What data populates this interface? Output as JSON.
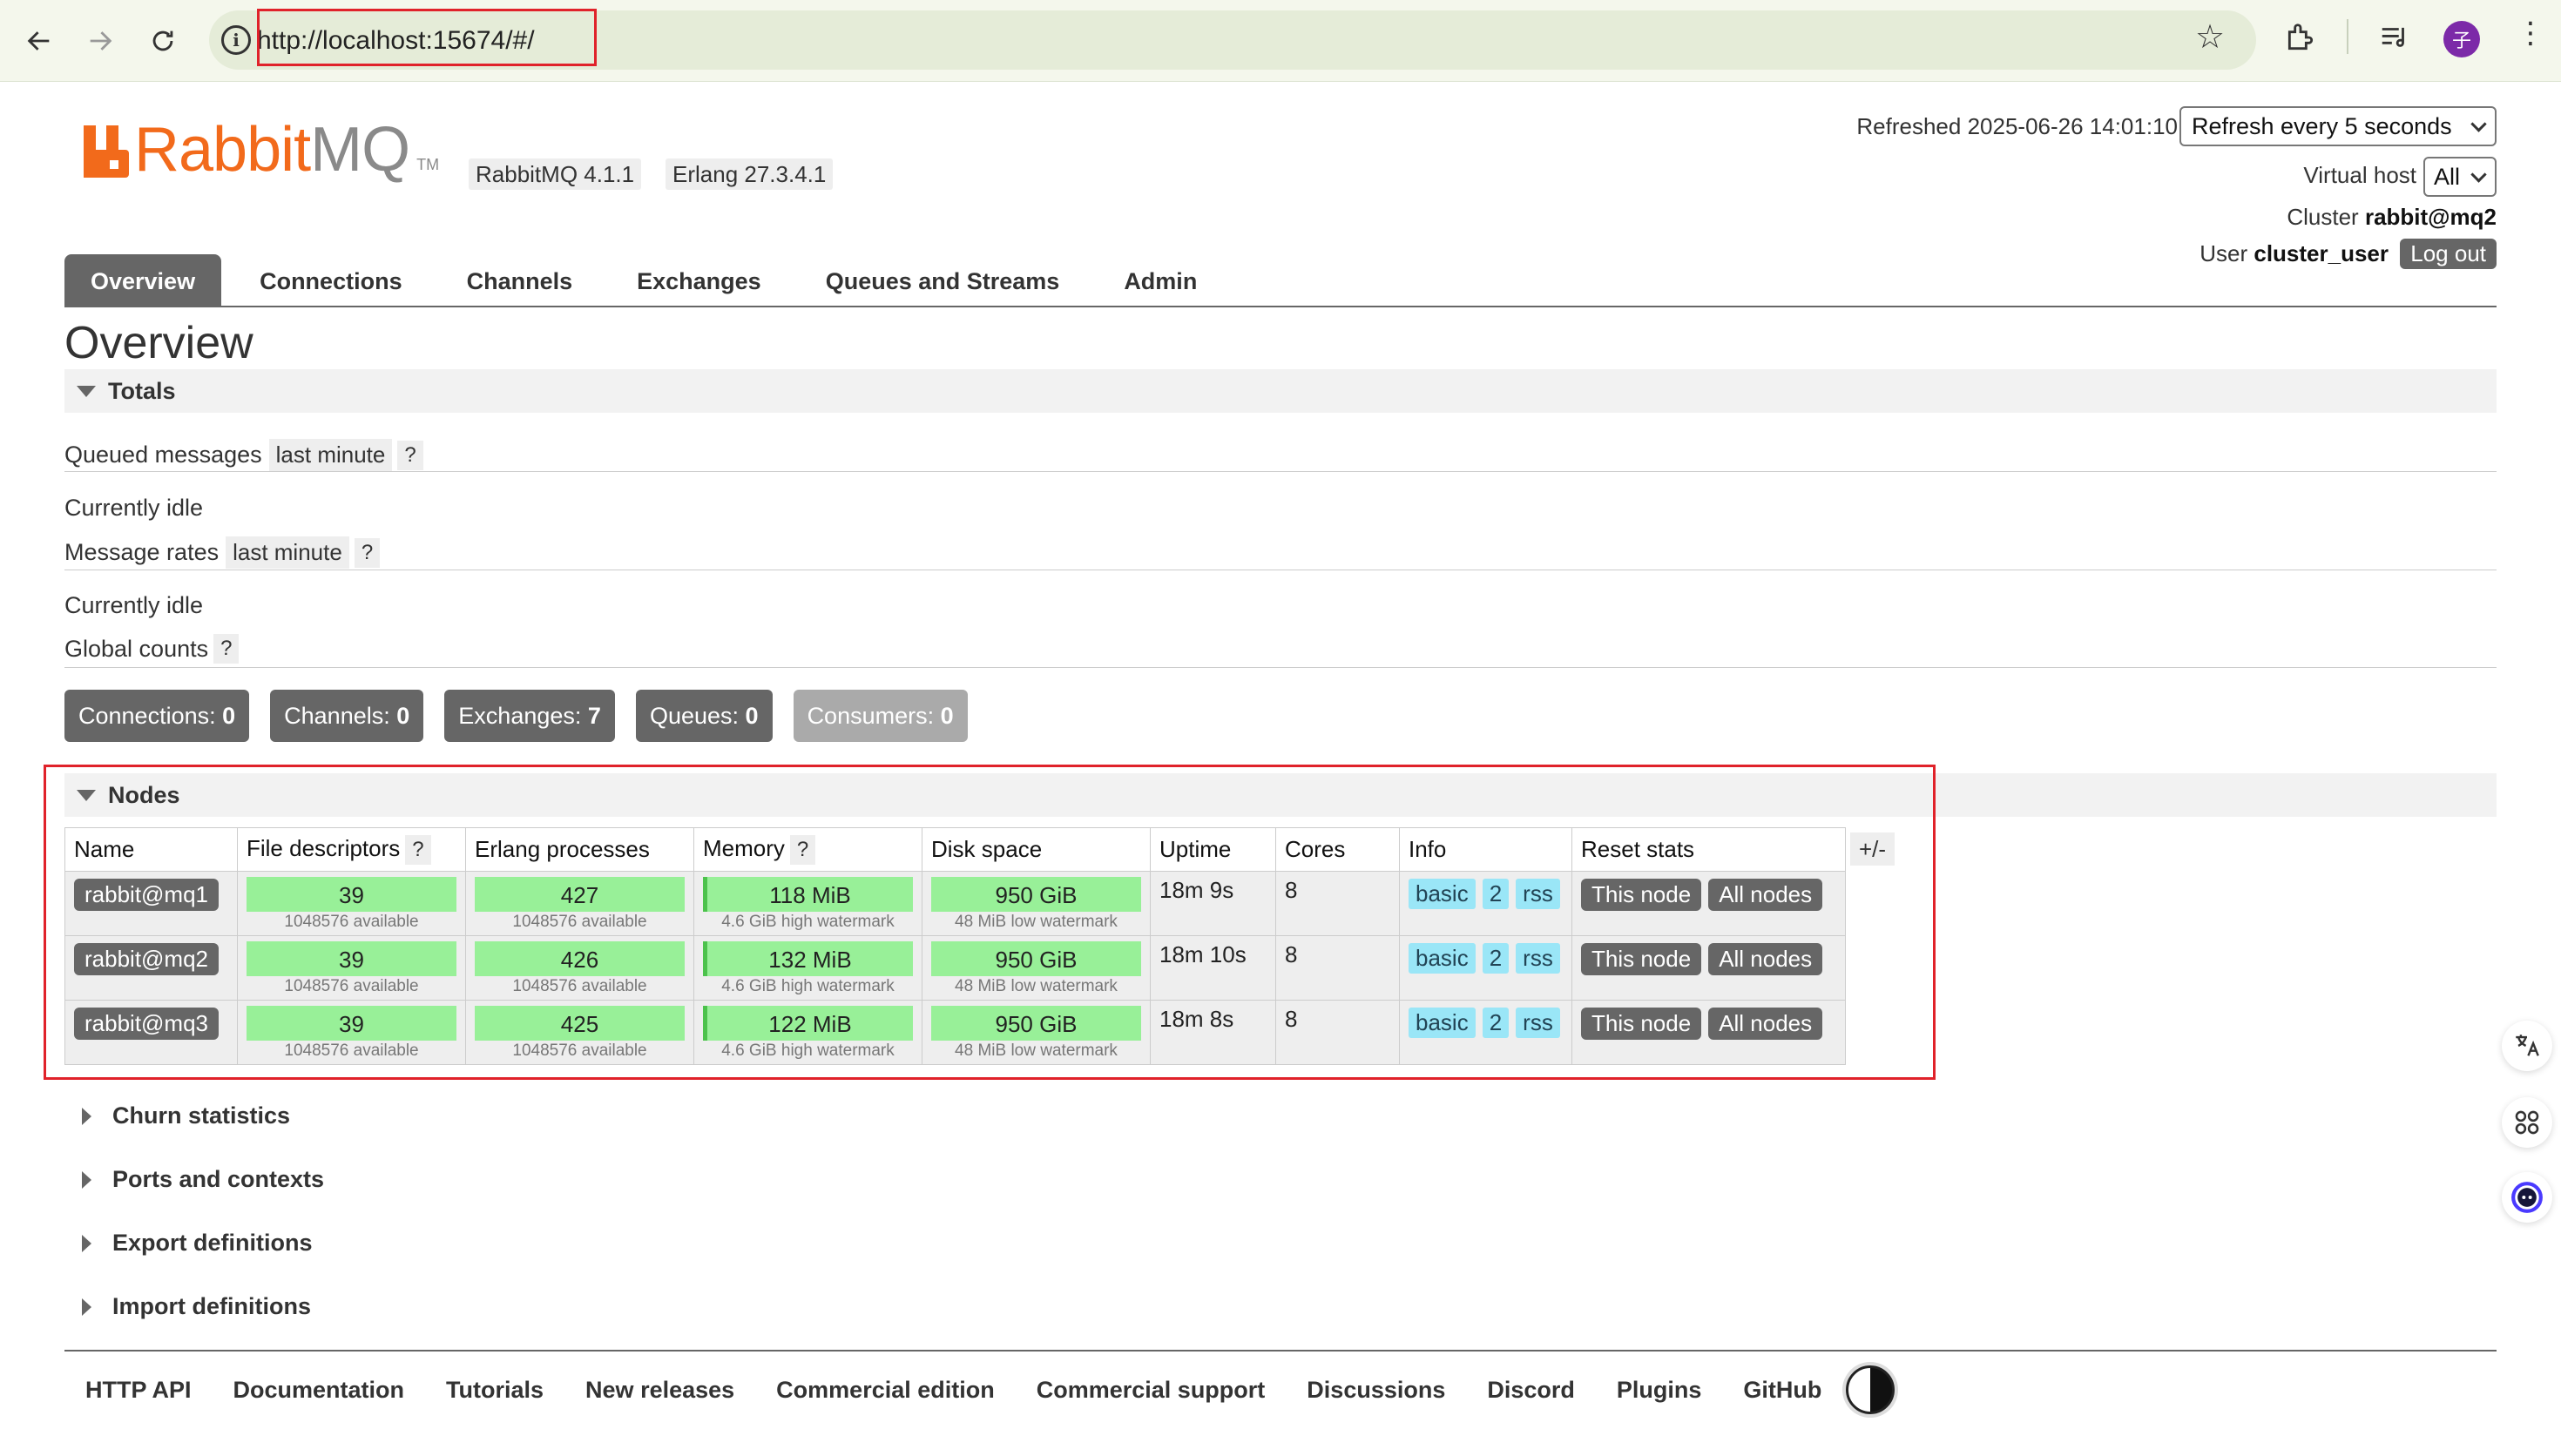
{
  "browser": {
    "url": "http://localhost:15674/#/",
    "avatar_letter": "子"
  },
  "header": {
    "logo_rabbit": "Rabbit",
    "logo_mq": "MQ",
    "logo_tm": "TM",
    "rabbitmq_version": "RabbitMQ 4.1.1",
    "erlang_version": "Erlang 27.3.4.1",
    "refreshed_label": "Refreshed 2025-06-26 14:01:10",
    "refresh_select": "Refresh every 5 seconds",
    "vhost_label": "Virtual host",
    "vhost_select": "All",
    "cluster_label": "Cluster",
    "cluster_name": "rabbit@mq2",
    "user_label": "User",
    "user_name": "cluster_user",
    "logout_label": "Log out"
  },
  "tabs": [
    "Overview",
    "Connections",
    "Channels",
    "Exchanges",
    "Queues and Streams",
    "Admin"
  ],
  "page_title": "Overview",
  "totals": {
    "heading": "Totals",
    "queued_label": "Queued messages",
    "queued_range": "last minute",
    "rates_label": "Message rates",
    "rates_range": "last minute",
    "help": "?",
    "idle_1": "Currently idle",
    "idle_2": "Currently idle",
    "global_label": "Global counts"
  },
  "counts": [
    {
      "label": "Connections:",
      "value": "0"
    },
    {
      "label": "Channels:",
      "value": "0"
    },
    {
      "label": "Exchanges:",
      "value": "7"
    },
    {
      "label": "Queues:",
      "value": "0"
    },
    {
      "label": "Consumers:",
      "value": "0"
    }
  ],
  "nodes": {
    "heading": "Nodes",
    "columns": [
      "Name",
      "File descriptors",
      "Erlang processes",
      "Memory",
      "Disk space",
      "Uptime",
      "Cores",
      "Info",
      "Reset stats"
    ],
    "plus_minus": "+/-",
    "rows": [
      {
        "name": "rabbit@mq1",
        "fd": "39",
        "fd_sub": "1048576 available",
        "proc": "427",
        "proc_sub": "1048576 available",
        "mem": "118 MiB",
        "mem_sub": "4.6 GiB high watermark",
        "disk": "950 GiB",
        "disk_sub": "48 MiB low watermark",
        "uptime": "18m 9s",
        "cores": "8",
        "info": [
          "basic",
          "2",
          "rss"
        ],
        "reset": [
          "This node",
          "All nodes"
        ]
      },
      {
        "name": "rabbit@mq2",
        "fd": "39",
        "fd_sub": "1048576 available",
        "proc": "426",
        "proc_sub": "1048576 available",
        "mem": "132 MiB",
        "mem_sub": "4.6 GiB high watermark",
        "disk": "950 GiB",
        "disk_sub": "48 MiB low watermark",
        "uptime": "18m 10s",
        "cores": "8",
        "info": [
          "basic",
          "2",
          "rss"
        ],
        "reset": [
          "This node",
          "All nodes"
        ]
      },
      {
        "name": "rabbit@mq3",
        "fd": "39",
        "fd_sub": "1048576 available",
        "proc": "425",
        "proc_sub": "1048576 available",
        "mem": "122 MiB",
        "mem_sub": "4.6 GiB high watermark",
        "disk": "950 GiB",
        "disk_sub": "48 MiB low watermark",
        "uptime": "18m 8s",
        "cores": "8",
        "info": [
          "basic",
          "2",
          "rss"
        ],
        "reset": [
          "This node",
          "All nodes"
        ]
      }
    ]
  },
  "collapsed_sections": [
    "Churn statistics",
    "Ports and contexts",
    "Export definitions",
    "Import definitions"
  ],
  "footer": [
    "HTTP API",
    "Documentation",
    "Tutorials",
    "New releases",
    "Commercial edition",
    "Commercial support",
    "Discussions",
    "Discord",
    "Plugins",
    "GitHub"
  ],
  "colors": {
    "brand_orange": "#f26a1b",
    "bar_green": "#98f098",
    "info_blue": "#9ae6f7",
    "highlight_red": "#e0222a"
  }
}
